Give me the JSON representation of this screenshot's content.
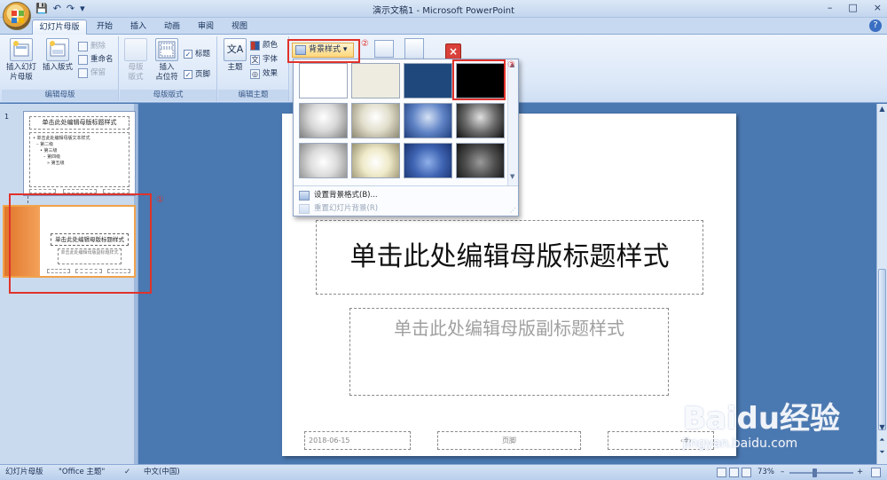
{
  "window": {
    "title": "演示文稿1 - Microsoft PowerPoint",
    "controls": [
      "–",
      "□",
      "×"
    ]
  },
  "qat": [
    "💾",
    "↶",
    "↷",
    "▾"
  ],
  "tabs": [
    {
      "label": "幻灯片母版",
      "active": true
    },
    {
      "label": "开始"
    },
    {
      "label": "插入"
    },
    {
      "label": "动画"
    },
    {
      "label": "审阅"
    },
    {
      "label": "视图"
    }
  ],
  "help": "?",
  "ribbon": {
    "edit_master": {
      "label": "编辑母版",
      "insert_slide_master": "插入幻灯\n片母版",
      "insert_layout": "插入版式",
      "delete": "删除",
      "rename": "重命名",
      "preserve": "保留"
    },
    "master_layout": {
      "label": "母版版式",
      "master_layout_btn": "母版\n版式",
      "insert_placeholder": "插入\n占位符",
      "title_check": "标题",
      "footer_check": "页脚"
    },
    "edit_theme": {
      "label": "编辑主题",
      "themes": "主题",
      "colors": "颜色",
      "fonts": "字体",
      "effects": "效果"
    },
    "background_styles": "背景样式"
  },
  "annotations": [
    "①",
    "②",
    "③"
  ],
  "dropdown": {
    "swatches": [
      {
        "bg": "#ffffff"
      },
      {
        "bg": "#eeece1"
      },
      {
        "bg": "#1f497d"
      },
      {
        "bg": "#000000"
      },
      {
        "bg": "radial-gradient(circle at 50% 40%, #ffffff 0%, #d8d8d8 45%, #7d7d7d 100%)"
      },
      {
        "bg": "radial-gradient(circle at 50% 40%, #ffffff 0%, #e2dfcd 45%, #8d8870 100%)"
      },
      {
        "bg": "radial-gradient(circle at 50% 40%, #d5e1f5 0%, #5f83c5 50%, #203f7f 100%)"
      },
      {
        "bg": "radial-gradient(circle at 50% 40%, #e0e0e0 0%, #6a6a6a 50%, #111111 100%)"
      },
      {
        "bg": "radial-gradient(circle at 50% 55%, #ffffff 0%, #dcdcdc 45%, #8b8b8b 100%)"
      },
      {
        "bg": "radial-gradient(circle at 50% 55%, #ffffff 0%, #efeac9 45%, #9a9270 100%)"
      },
      {
        "bg": "radial-gradient(circle at 50% 55%, #8fb0ea 0%, #3f64b2 50%, #1a3370 100%)"
      },
      {
        "bg": "radial-gradient(circle at 50% 55%, #9a9a9a 0%, #4e4e4e 50%, #141414 100%)"
      }
    ],
    "format_background": "设置背景格式(B)...",
    "reset_background": "重置幻灯片背景(R)"
  },
  "thumbnails": {
    "slide_number": "1",
    "thumb1_title": "单击此处编辑母版标题样式",
    "thumb1_body": [
      "• 单击此处编辑母版文本样式",
      "– 第二级",
      "• 第三级",
      "– 第四级",
      "» 第五级"
    ],
    "thumb2_title": "单击此处编辑母版标题样式",
    "thumb2_sub": "单击此处编辑母版副标题样式"
  },
  "slide": {
    "title": "单击此处编辑母版标题样式",
    "subtitle": "单击此处编辑母版副标题样式",
    "date": "2018-06-15",
    "footer": "页脚",
    "page_number": "‹#›"
  },
  "statusbar": {
    "view": "幻灯片母版",
    "theme": "\"Office 主题\"",
    "language": "中文(中国)",
    "zoom": "73%",
    "zoom_minus": "–",
    "zoom_plus": "+"
  },
  "watermark": {
    "brand": "Baidu经验",
    "url": "jingyan.baidu.com"
  }
}
